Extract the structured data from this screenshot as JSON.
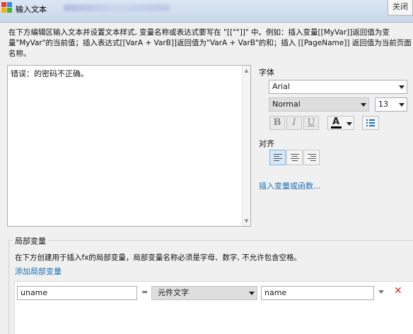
{
  "window": {
    "title": "输入文本",
    "close_label": "关闭"
  },
  "description": "在下方编辑区输入文本并设置文本样式, 变量名称或表达式要写在 \"[[\"\"]]\" 中。例如：插入变量[[MyVar]]返回值为变量\"MyVar\"的当前值；插入表达式[[VarA + VarB]]返回值为\"VarA + VarB\"的和；插入 [[PageName]] 返回值为当前页面名称。",
  "editor": {
    "text": "错误：的密码不正确。"
  },
  "font": {
    "section_label": "字体",
    "family": "Arial",
    "weight": "Normal",
    "size": "13",
    "bold": "B",
    "italic": "I",
    "underline": "U",
    "text_color_glyph": "A"
  },
  "align": {
    "section_label": "对齐",
    "selected": "left"
  },
  "insert_link": "插入变量或函数...",
  "local_vars": {
    "section_label": "局部变量",
    "hint": "在下方创建用于插入fx的局部变量，局部变量名称必须是字母、数字, 不允许包含空格。",
    "add_link": "添加局部变量",
    "rows": [
      {
        "name": "uname",
        "equals": "=",
        "type": "元件文字",
        "target": "name"
      }
    ]
  },
  "colors": {
    "link": "#1c6fb5",
    "delete": "#e0261b",
    "text_color_bar": "#000000"
  }
}
